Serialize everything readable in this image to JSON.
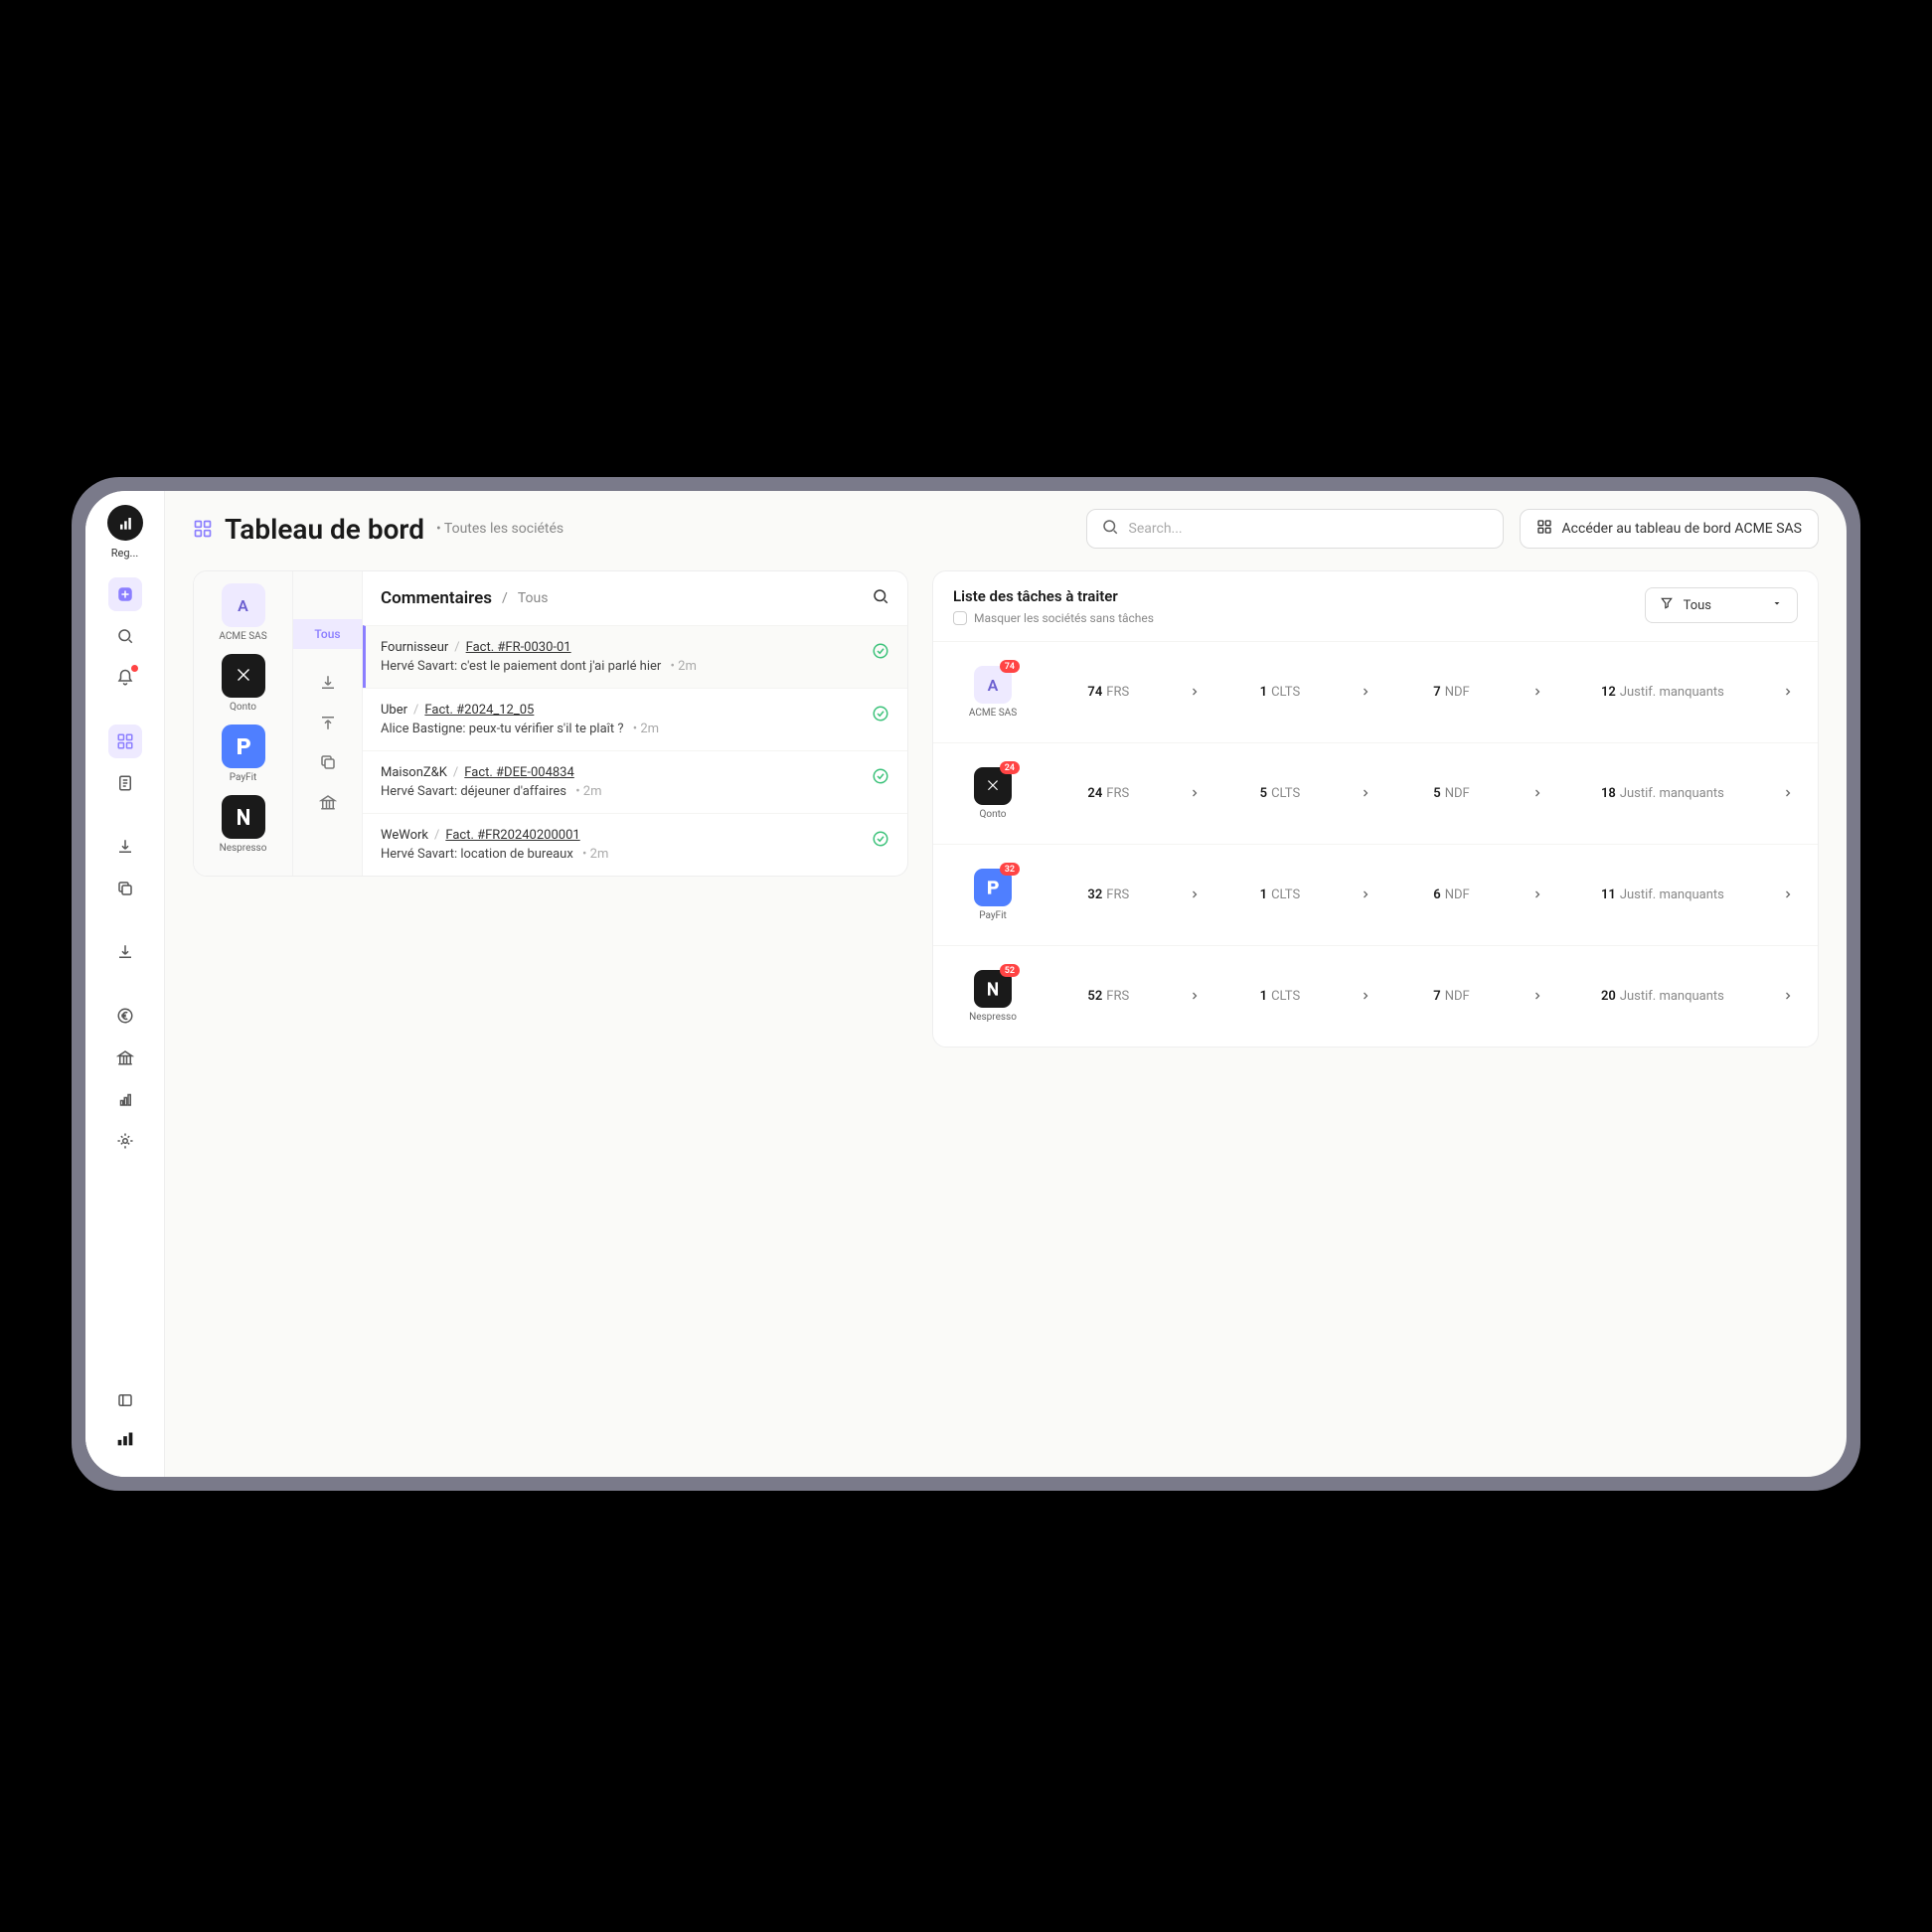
{
  "app": {
    "logo_label": "Reg...",
    "title": "Tableau de bord",
    "subtitle": "• Toutes les sociétés"
  },
  "search": {
    "placeholder": "Search..."
  },
  "access_button": "Accéder au tableau de bord ACME SAS",
  "companies": [
    {
      "name": "ACME SAS",
      "letter": "A",
      "class": "acme"
    },
    {
      "name": "Qonto",
      "class": "qonto"
    },
    {
      "name": "PayFit",
      "class": "payfit"
    },
    {
      "name": "Nespresso",
      "class": "nesp"
    }
  ],
  "comments": {
    "title": "Commentaires",
    "crumb_sep": "/",
    "crumb": "Tous",
    "filter_label": "Tous",
    "items": [
      {
        "active": true,
        "source": "Fournisseur",
        "ref": "Fact. #FR-0030-01",
        "author": "Hervé Savart",
        "text": "c'est le paiement dont j'ai parlé hier",
        "time": "2m"
      },
      {
        "source": "Uber",
        "ref": "Fact. #2024_12_05",
        "author": "Alice Bastigne",
        "text": "peux-tu vérifier s'il te plaît ?",
        "time": "2m"
      },
      {
        "source": "MaisonZ&K",
        "ref": "Fact. #DEE-004834",
        "author": "Hervé Savart",
        "text": "déjeuner d'affaires",
        "time": "2m"
      },
      {
        "source": "WeWork",
        "ref": "Fact. #FR20240200001",
        "author": "Hervé Savart",
        "text": "location de bureaux",
        "time": "2m"
      }
    ]
  },
  "tasks": {
    "title": "Liste des tâches à traiter",
    "hide_label": "Masquer les sociétés sans tâches",
    "filter": "Tous",
    "labels": {
      "frs": "FRS",
      "clts": "CLTS",
      "ndf": "NDF",
      "missing": "Justif. manquants"
    },
    "rows": [
      {
        "company": "ACME SAS",
        "class": "acme",
        "letter": "A",
        "badge": "74",
        "frs": "74",
        "clts": "1",
        "ndf": "7",
        "missing": "12"
      },
      {
        "company": "Qonto",
        "class": "qonto",
        "badge": "24",
        "frs": "24",
        "clts": "5",
        "ndf": "5",
        "missing": "18"
      },
      {
        "company": "PayFit",
        "class": "payfit",
        "badge": "32",
        "frs": "32",
        "clts": "1",
        "ndf": "6",
        "missing": "11"
      },
      {
        "company": "Nespresso",
        "class": "nesp",
        "badge": "52",
        "frs": "52",
        "clts": "1",
        "ndf": "7",
        "missing": "20"
      }
    ]
  }
}
